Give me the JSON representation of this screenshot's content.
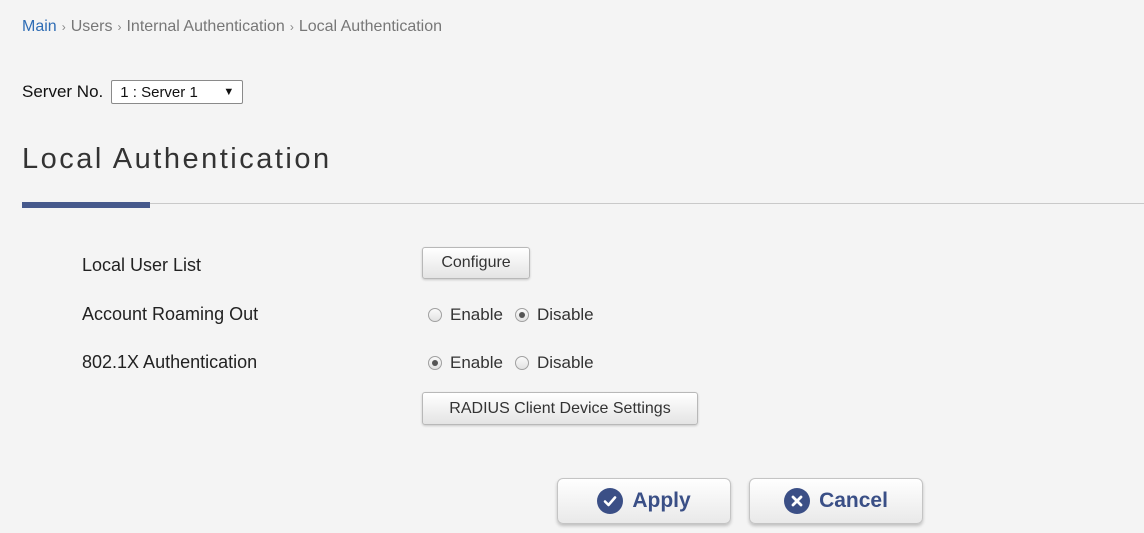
{
  "breadcrumb": {
    "items": [
      "Main",
      "Users",
      "Internal Authentication",
      "Local Authentication"
    ],
    "separator": "›"
  },
  "server": {
    "label": "Server No.",
    "selected": "1 : Server 1"
  },
  "page_title": "Local Authentication",
  "rows": {
    "local_user_list": {
      "label": "Local User List",
      "button": "Configure"
    },
    "account_roaming_out": {
      "label": "Account Roaming Out",
      "enable": "Enable",
      "disable": "Disable",
      "selected": "Disable"
    },
    "dot1x": {
      "label": "802.1X Authentication",
      "enable": "Enable",
      "disable": "Disable",
      "selected": "Enable",
      "button": "RADIUS Client Device Settings"
    }
  },
  "actions": {
    "apply": "Apply",
    "cancel": "Cancel"
  },
  "icons": {
    "apply": "check-circle-icon",
    "cancel": "x-circle-icon",
    "select": "triangle-down-icon"
  },
  "colors": {
    "link": "#2f6db5",
    "accent": "#46598c",
    "button_text": "#3a4f86"
  }
}
